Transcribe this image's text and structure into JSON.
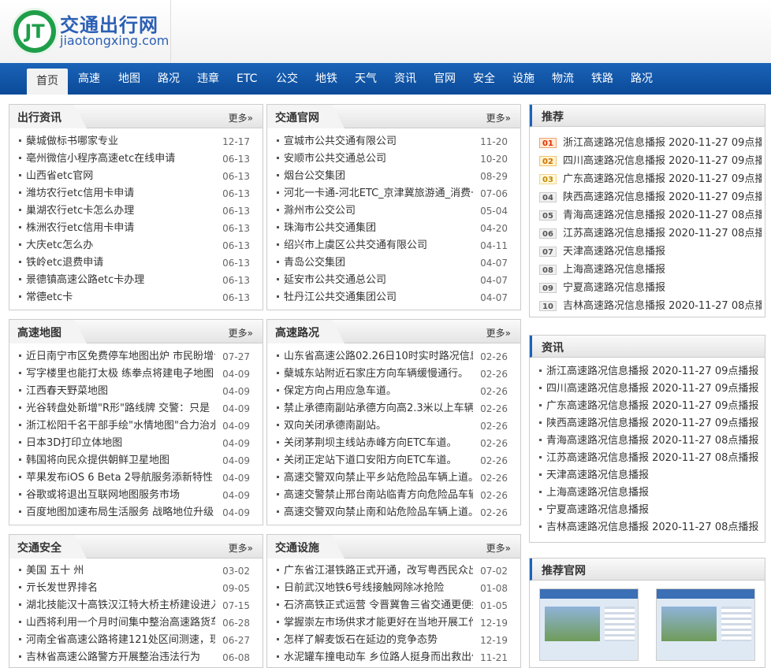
{
  "header": {
    "logo_mark": "JT",
    "site_name": "交通出行网",
    "site_domain": "jiaotongxing.com"
  },
  "nav": [
    "首页",
    "高速",
    "地图",
    "路况",
    "违章",
    "ETC",
    "公交",
    "地铁",
    "天气",
    "资讯",
    "官网",
    "安全",
    "设施",
    "物流",
    "铁路",
    "路况"
  ],
  "more_label": "更多»",
  "boxes": {
    "travel": {
      "title": "出行资讯",
      "items": [
        {
          "t": "蘖城做标书哪家专业",
          "d": "12-17"
        },
        {
          "t": "亳州微信小程序高速etc在线申请",
          "d": "06-13"
        },
        {
          "t": "山西省etc官网",
          "d": "06-13"
        },
        {
          "t": "潍坊农行etc信用卡申请",
          "d": "06-13"
        },
        {
          "t": "巢湖农行etc卡怎么办理",
          "d": "06-13"
        },
        {
          "t": "株洲农行etc信用卡申请",
          "d": "06-13"
        },
        {
          "t": "大庆etc怎么办",
          "d": "06-13"
        },
        {
          "t": "铁岭etc退费申请",
          "d": "06-13"
        },
        {
          "t": "景德镇高速公路etc卡办理",
          "d": "06-13"
        },
        {
          "t": "常德etc卡",
          "d": "06-13"
        }
      ]
    },
    "official": {
      "title": "交通官网",
      "items": [
        {
          "t": "宣城市公共交通有限公司",
          "d": "11-20"
        },
        {
          "t": "安顺市公共交通总公司",
          "d": "10-20"
        },
        {
          "t": "烟台公交集团",
          "d": "08-29"
        },
        {
          "t": "河北一卡通-河北ETC_京津冀旅游通_消费一",
          "d": "07-06"
        },
        {
          "t": "滁州市公交公司",
          "d": "05-04"
        },
        {
          "t": "珠海市公共交通集团",
          "d": "04-20"
        },
        {
          "t": "绍兴市上虞区公共交通有限公司",
          "d": "04-11"
        },
        {
          "t": "青岛公交集团",
          "d": "04-07"
        },
        {
          "t": "延安市公共交通总公司",
          "d": "04-07"
        },
        {
          "t": "牡丹江公共交通集团公司",
          "d": "04-07"
        }
      ]
    },
    "maps": {
      "title": "高速地图",
      "items": [
        {
          "t": "近日南宁市区免费停车地图出炉 市民盼增设",
          "d": "07-27"
        },
        {
          "t": "写字楼里也能打太极 练拳点将建电子地图",
          "d": "04-09"
        },
        {
          "t": "江西春天野菜地图",
          "d": "04-09"
        },
        {
          "t": "光谷转盘处新增\"R形\"路线牌 交警：只是",
          "d": "04-09"
        },
        {
          "t": "浙江松阳千名干部手绘\"水情地图\"合力治水",
          "d": "04-09"
        },
        {
          "t": "日本3D打印立体地图",
          "d": "04-09"
        },
        {
          "t": "韩国将向民众提供朝鲜卫星地图",
          "d": "04-09"
        },
        {
          "t": "苹果发布iOS 6 Beta 2导航服务添新特性",
          "d": "04-09"
        },
        {
          "t": "谷歌或将退出互联网地图服务市场",
          "d": "04-09"
        },
        {
          "t": "百度地图加速布局生活服务 战略地位升级",
          "d": "04-09"
        }
      ]
    },
    "roads": {
      "title": "高速路况",
      "items": [
        {
          "t": "山东省高速公路02.26日10时实时路况信息",
          "d": "02-26"
        },
        {
          "t": "蘖城东站附近石家庄方向车辆缓慢通行。",
          "d": "02-26"
        },
        {
          "t": "保定方向占用应急车道。",
          "d": "02-26"
        },
        {
          "t": "禁止承德南副站承德方向高2.3米以上车辆下",
          "d": "02-26"
        },
        {
          "t": "双向关闭承德南副站。",
          "d": "02-26"
        },
        {
          "t": "关闭茅荆坝主线站赤峰方向ETC车道。",
          "d": "02-26"
        },
        {
          "t": "关闭正定站下道口安阳方向ETC车道。",
          "d": "02-26"
        },
        {
          "t": "高速交警双向禁止平乡站危险品车辆上道。",
          "d": "02-26"
        },
        {
          "t": "高速交警禁止邢台南站临青方向危险品车辆上",
          "d": "02-26"
        },
        {
          "t": "高速交警双向禁止南和站危险品车辆上道。",
          "d": "02-26"
        }
      ]
    },
    "safety": {
      "title": "交通安全",
      "items": [
        {
          "t": "美国 五十 州",
          "d": "03-02"
        },
        {
          "t": "亓长发世界排名",
          "d": "09-05"
        },
        {
          "t": "湖北技能汉十高铁汉江特大桥主桥建设进入最",
          "d": "07-15"
        },
        {
          "t": "山西将利用一个月时间集中整治高速路货车行",
          "d": "06-28"
        },
        {
          "t": "河南全省高速公路将建121处区间测速，现已",
          "d": "06-27"
        },
        {
          "t": "吉林省高速公路警方开展整治违法行为",
          "d": "06-08"
        }
      ]
    },
    "facility": {
      "title": "交通设施",
      "items": [
        {
          "t": "广东省江湛铁路正式开通，改写粤西民众出行",
          "d": "07-02"
        },
        {
          "t": "日前武汉地铁6号线接触网除冰抢险",
          "d": "01-08"
        },
        {
          "t": "石济高铁正式运营 令晋冀鲁三省交通更便捷",
          "d": "01-05"
        },
        {
          "t": "掌握崇左市场供求才能更好在当地开展工作",
          "d": "12-19"
        },
        {
          "t": "怎样了解麦饭石在延边的竞争态势",
          "d": "12-19"
        },
        {
          "t": "水泥罐车撞电动车 乡位路人挺身而出救出伤",
          "d": "11-21"
        }
      ]
    }
  },
  "side": {
    "recommend": {
      "title": "推荐",
      "items": [
        {
          "n": "01",
          "t": "浙江高速路况信息播报 2020-11-27 09点播"
        },
        {
          "n": "02",
          "t": "四川高速路况信息播报 2020-11-27 09点播"
        },
        {
          "n": "03",
          "t": "广东高速路况信息播报 2020-11-27 09点播"
        },
        {
          "n": "04",
          "t": "陕西高速路况信息播报 2020-11-27 09点播"
        },
        {
          "n": "05",
          "t": "青海高速路况信息播报 2020-11-27 08点播"
        },
        {
          "n": "06",
          "t": "江苏高速路况信息播报 2020-11-27 08点播"
        },
        {
          "n": "07",
          "t": "天津高速路况信息播报"
        },
        {
          "n": "08",
          "t": "上海高速路况信息播报"
        },
        {
          "n": "09",
          "t": "宁夏高速路况信息播报"
        },
        {
          "n": "10",
          "t": "吉林高速路况信息播报 2020-11-27 08点播"
        }
      ]
    },
    "news": {
      "title": "资讯",
      "items": [
        "浙江高速路况信息播报 2020-11-27 09点播报",
        "四川高速路况信息播报 2020-11-27 09点播报",
        "广东高速路况信息播报 2020-11-27 09点播报",
        "陕西高速路况信息播报 2020-11-27 09点播报",
        "青海高速路况信息播报 2020-11-27 08点播报",
        "江苏高速路况信息播报 2020-11-27 08点播报",
        "天津高速路况信息播报",
        "上海高速路况信息播报",
        "宁夏高速路况信息播报",
        "吉林高速路况信息播报 2020-11-27 08点播报"
      ]
    },
    "sites": {
      "title": "推荐官网"
    }
  }
}
